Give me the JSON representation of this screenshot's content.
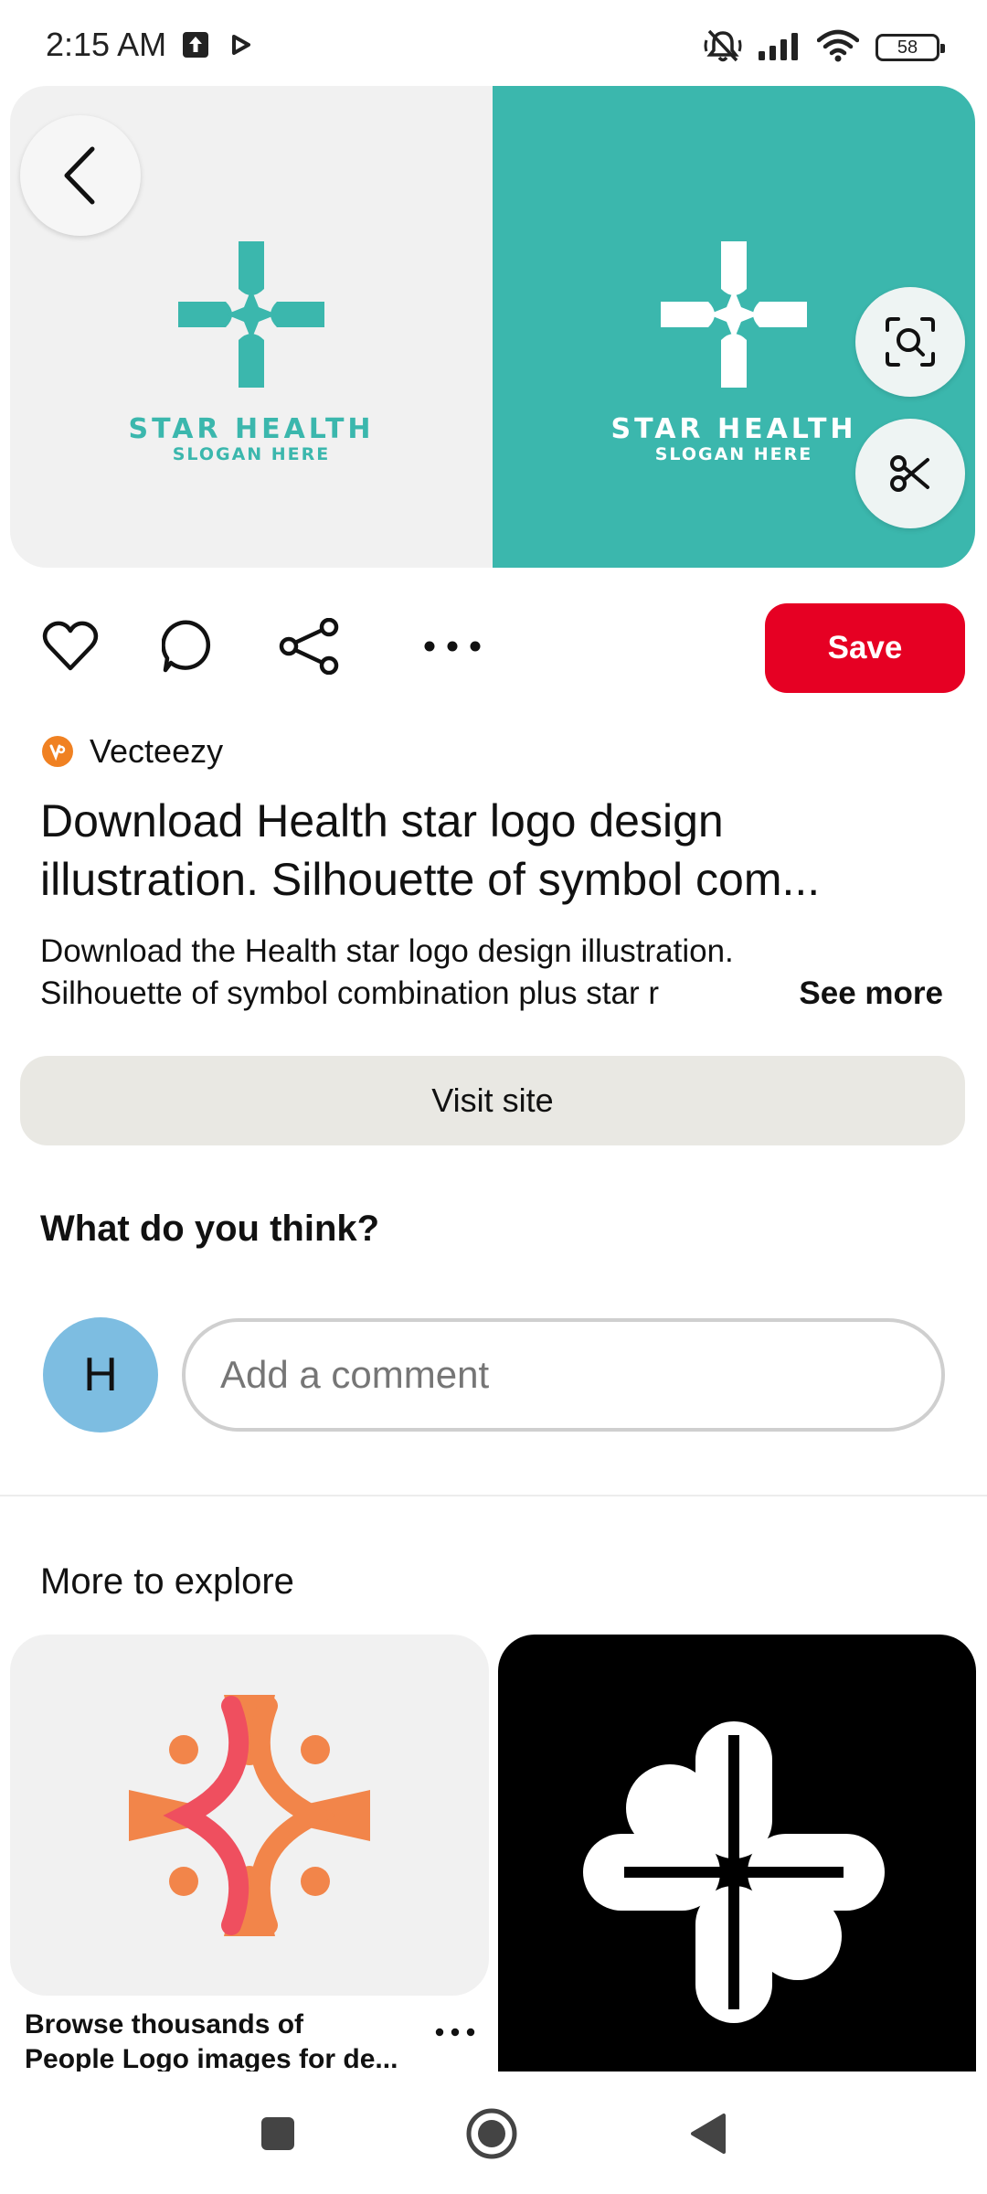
{
  "status_bar": {
    "time": "2:15 AM",
    "battery": "58",
    "icons": [
      "upload-notification-icon",
      "play-notification-icon",
      "mute-icon",
      "signal-icon",
      "wifi-icon",
      "battery-icon"
    ]
  },
  "hero": {
    "left_logo": {
      "name": "STAR HEALTH",
      "slogan": "SLOGAN HERE"
    },
    "right_logo": {
      "name": "STAR HEALTH",
      "slogan": "SLOGAN HERE"
    },
    "colors": {
      "teal": "#3bb7ad",
      "light": "#f1f1f1"
    }
  },
  "actions": {
    "icons": [
      "heart-icon",
      "comment-icon",
      "share-icon",
      "more-icon"
    ],
    "save_label": "Save",
    "save_color": "#e60023"
  },
  "pin": {
    "source": "Vecteezy",
    "title_line1": "Download Health star logo design",
    "title_line2": "illustration. Silhouette of symbol com...",
    "desc_line1": "Download the Health star logo design illustration.",
    "desc_line2": "Silhouette of symbol combination plus star r",
    "see_more": "See more"
  },
  "visit_label": "Visit site",
  "comments": {
    "heading": "What do you think?",
    "avatar_initial": "H",
    "placeholder": "Add a comment"
  },
  "explore": {
    "heading": "More to explore",
    "cards": [
      {
        "caption_line1": "Browse thousands of",
        "caption_line2": "People Logo images for de..."
      }
    ]
  },
  "nav": {
    "icons": [
      "recents-square-icon",
      "home-circle-icon",
      "back-triangle-icon"
    ]
  }
}
